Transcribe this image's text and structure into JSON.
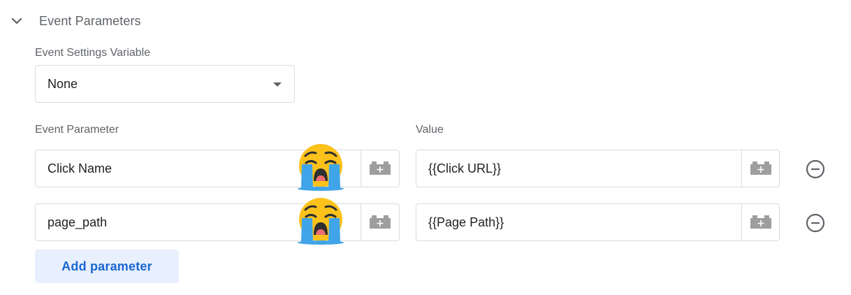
{
  "section": {
    "title": "Event Parameters",
    "expanded": true
  },
  "settings_variable": {
    "label": "Event Settings Variable",
    "value": "None"
  },
  "columns": {
    "parameter": "Event Parameter",
    "value": "Value"
  },
  "rows": [
    {
      "parameter": "Click Name",
      "value": "{{Click URL}}"
    },
    {
      "parameter": "page_path",
      "value": "{{Page Path}}"
    }
  ],
  "add_button": {
    "label": "Add parameter"
  },
  "colors": {
    "accent": "#1967d2",
    "button_bg": "#e8f0fe",
    "border": "#dadce0",
    "muted_text": "#5f6368"
  },
  "icons": {
    "section_toggle": "chevron-down-icon",
    "variable_picker": "variable-brick-icon",
    "remove_row": "remove-circle-icon",
    "overlay": "crying-face-emoji"
  }
}
